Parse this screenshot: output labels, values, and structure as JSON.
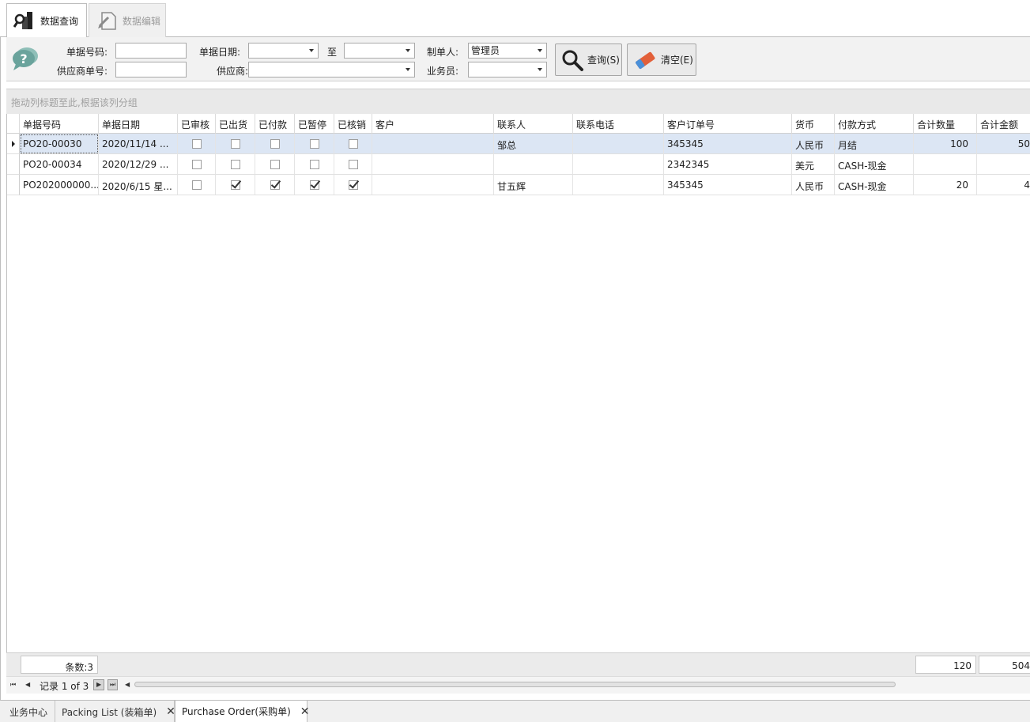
{
  "tabs": {
    "query": "数据查询",
    "edit": "数据编辑"
  },
  "filter": {
    "doc_no_label": "单据号码:",
    "doc_date_label": "单据日期:",
    "to_label": "至",
    "creator_label": "制单人:",
    "creator_value": "管理员",
    "supplier_doc_label": "供应商单号:",
    "supplier_label": "供应商:",
    "salesman_label": "业务员:",
    "query_button": "查询(S)",
    "clear_button": "清空(E)"
  },
  "group_hint": "拖动列标题至此,根据该列分组",
  "grid": {
    "columns": [
      "单据号码",
      "单据日期",
      "已审核",
      "已出货",
      "已付款",
      "已暂停",
      "已核销",
      "客户",
      "联系人",
      "联系电话",
      "客户订单号",
      "货币",
      "付款方式",
      "合计数量",
      "合计金额"
    ],
    "rows": [
      {
        "doc_no": "PO20-00030",
        "date": "2020/11/14 ...",
        "audited": false,
        "shipped": false,
        "paid": false,
        "paused": false,
        "written_off": false,
        "customer": "",
        "contact": "邹总",
        "phone": "",
        "cust_order": "345345",
        "currency": "人民币",
        "payment": "月结",
        "qty": "100",
        "amount": "50"
      },
      {
        "doc_no": "PO20-00034",
        "date": "2020/12/29 ...",
        "audited": false,
        "shipped": false,
        "paid": false,
        "paused": false,
        "written_off": false,
        "customer": "",
        "contact": "",
        "phone": "",
        "cust_order": "2342345",
        "currency": "美元",
        "payment": "CASH-现金",
        "qty": "",
        "amount": ""
      },
      {
        "doc_no": "PO202000000...",
        "date": "2020/6/15 星...",
        "audited": false,
        "shipped": true,
        "paid": true,
        "paused": true,
        "written_off": true,
        "customer": "",
        "contact": "甘五辉",
        "phone": "",
        "cust_order": "345345",
        "currency": "人民币",
        "payment": "CASH-现金",
        "qty": "20",
        "amount": "4"
      }
    ]
  },
  "footer": {
    "count": "条数:3",
    "total_qty": "120",
    "total_amount": "504"
  },
  "nav": {
    "record": "记录 1 of 3"
  },
  "bottom_tabs": [
    {
      "label": "业务中心",
      "closable": false
    },
    {
      "label": "Packing List (装箱单)",
      "closable": true
    },
    {
      "label": "Purchase Order(采购单)",
      "closable": true
    }
  ],
  "colors": {
    "selected_row": "#dce6f4",
    "panel": "#f2f2f2",
    "chat_icon": "#6aa39c"
  }
}
